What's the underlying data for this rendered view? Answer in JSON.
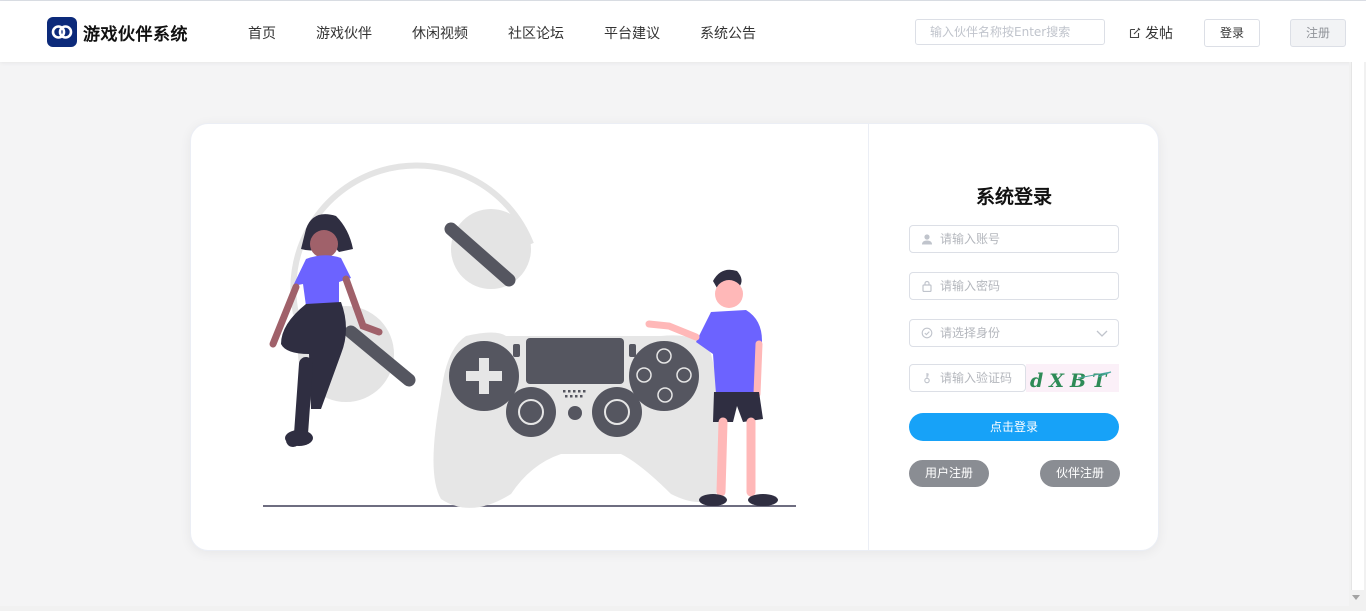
{
  "app": {
    "brand": "游戏伙伴系统"
  },
  "nav": {
    "items": [
      {
        "label": "首页"
      },
      {
        "label": "游戏伙伴"
      },
      {
        "label": "休闲视频"
      },
      {
        "label": "社区论坛"
      },
      {
        "label": "平台建议"
      },
      {
        "label": "系统公告"
      }
    ]
  },
  "header": {
    "search_placeholder": "输入伙伴名称按Enter搜索",
    "post_label": "发帖",
    "login_label": "登录",
    "register_label": "注册"
  },
  "login_form": {
    "title": "系统登录",
    "account_placeholder": "请输入账号",
    "password_placeholder": "请输入密码",
    "role_placeholder": "请选择身份",
    "captcha_placeholder": "请输入验证码",
    "captcha_text": "dXBT",
    "submit_label": "点击登录",
    "user_register_label": "用户注册",
    "partner_register_label": "伙伴注册"
  },
  "colors": {
    "brand_logo": "#0c2a7a",
    "primary_button": "#17a2f8",
    "secondary_button": "#8a8d93",
    "illustration_accent": "#6c63ff"
  },
  "icons": {
    "logo": "brand-logo-icon",
    "post": "edit-icon",
    "account": "user-icon",
    "password": "lock-icon",
    "role": "check-circle-icon",
    "captcha": "key-icon"
  }
}
